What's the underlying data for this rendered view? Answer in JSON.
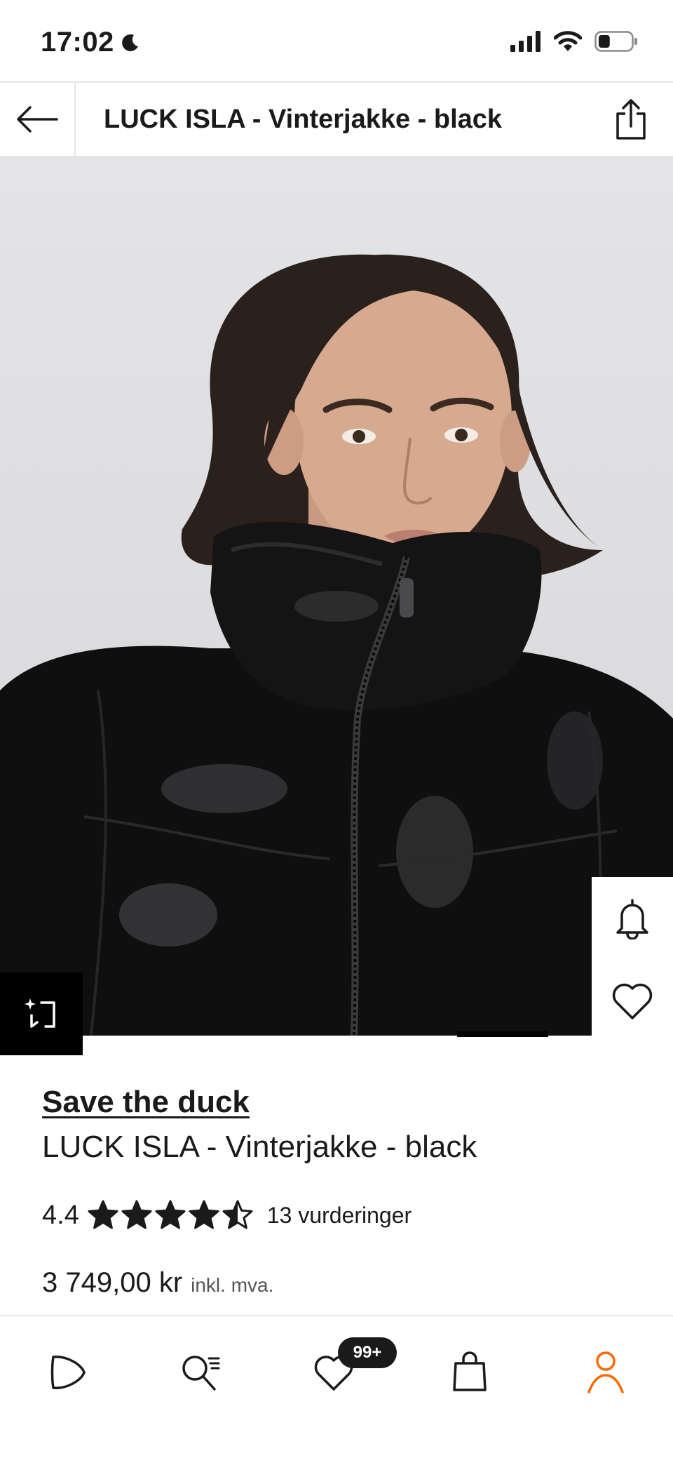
{
  "status_bar": {
    "time": "17:02",
    "battery_level": 0.35
  },
  "header": {
    "title": "LUCK ISLA - Vinterjakke - black"
  },
  "product": {
    "brand": "Save the duck",
    "name": "LUCK ISLA - Vinterjakke - black",
    "rating": "4.4",
    "rating_value": 4.4,
    "rating_max": 5,
    "review_count": "13 vurderinger",
    "price": "3 749,00 kr",
    "vat_note": "inkl. mva."
  },
  "nav": {
    "wishlist_badge": "99+",
    "active_tab": "profile",
    "accent_color": "#ff6900"
  },
  "icons": [
    "back-arrow-icon",
    "share-icon",
    "bell-icon",
    "heart-icon",
    "similar-items-icon",
    "home-icon",
    "search-icon",
    "wishlist-icon",
    "bag-icon",
    "profile-icon",
    "moon-icon",
    "signal-icon",
    "wifi-icon",
    "battery-icon"
  ]
}
